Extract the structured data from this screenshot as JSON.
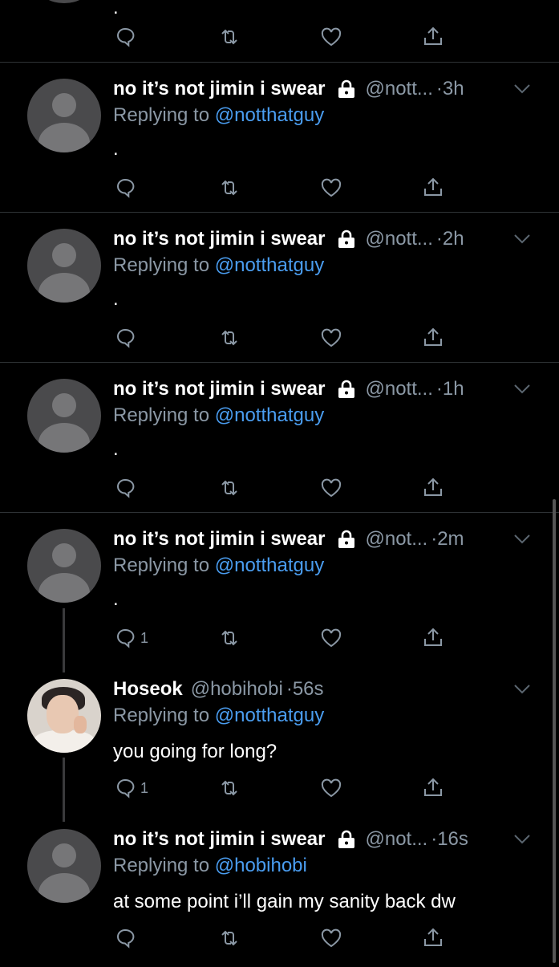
{
  "top": {
    "text": "."
  },
  "tweets": [
    {
      "name": "no it’s not jimin i swear",
      "handle": "@nott...",
      "time": "·3h",
      "replying_prefix": "Replying to ",
      "replying_to": "@notthatguy",
      "text": ".",
      "reply_count": ""
    },
    {
      "name": "no it’s not jimin i swear",
      "handle": "@nott...",
      "time": "·2h",
      "replying_prefix": "Replying to ",
      "replying_to": "@notthatguy",
      "text": ".",
      "reply_count": ""
    },
    {
      "name": "no it’s not jimin i swear",
      "handle": "@nott...",
      "time": "·1h",
      "replying_prefix": "Replying to ",
      "replying_to": "@notthatguy",
      "text": ".",
      "reply_count": ""
    },
    {
      "name": "no it’s not jimin i swear",
      "handle": "@not...",
      "time": "·2m",
      "replying_prefix": "Replying to ",
      "replying_to": "@notthatguy",
      "text": ".",
      "reply_count": "1"
    },
    {
      "name": "Hoseok",
      "handle": "@hobihobi",
      "time": "·56s",
      "replying_prefix": "Replying to ",
      "replying_to": "@notthatguy",
      "text": "you going for long?",
      "reply_count": "1"
    },
    {
      "name": "no it’s not jimin i swear",
      "handle": "@not...",
      "time": "·16s",
      "replying_prefix": "Replying to ",
      "replying_to": "@hobihobi",
      "text": "at some point i’ll gain my sanity back dw",
      "reply_count": ""
    }
  ],
  "icons": {
    "reply": "reply-icon",
    "retweet": "retweet-icon",
    "like": "like-icon",
    "share": "share-icon",
    "lock": "lock-icon",
    "more": "chevron-down-icon"
  },
  "colors": {
    "background": "#000000",
    "link": "#4a9df0",
    "muted": "#8b98a5"
  }
}
